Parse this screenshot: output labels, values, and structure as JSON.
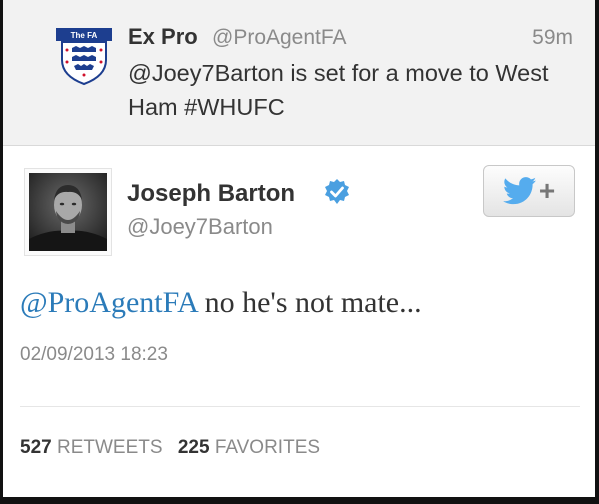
{
  "parent_tweet": {
    "name": "Ex Pro",
    "handle": "@ProAgentFA",
    "time": "59m",
    "text": "@Joey7Barton is set for a move to West Ham #WHUFC",
    "logo_text": "The FA"
  },
  "main_tweet": {
    "name": "Joseph Barton",
    "handle": "@Joey7Barton",
    "reply_mention": "@ProAgentFA",
    "reply_text": " no he's not mate...",
    "timestamp": "02/09/2013 18:23",
    "retweets_count": "527",
    "retweets_label": "RETWEETS",
    "favorites_count": "225",
    "favorites_label": "FAVORITES"
  },
  "icons": {
    "fa_logo": "fa-crest-logo",
    "verified": "verified-badge-icon",
    "follow": "twitter-bird-plus-icon"
  },
  "colors": {
    "link_blue": "#2b7bb9",
    "twitter_blue": "#55acee",
    "verified_blue": "#4a9fe0"
  }
}
